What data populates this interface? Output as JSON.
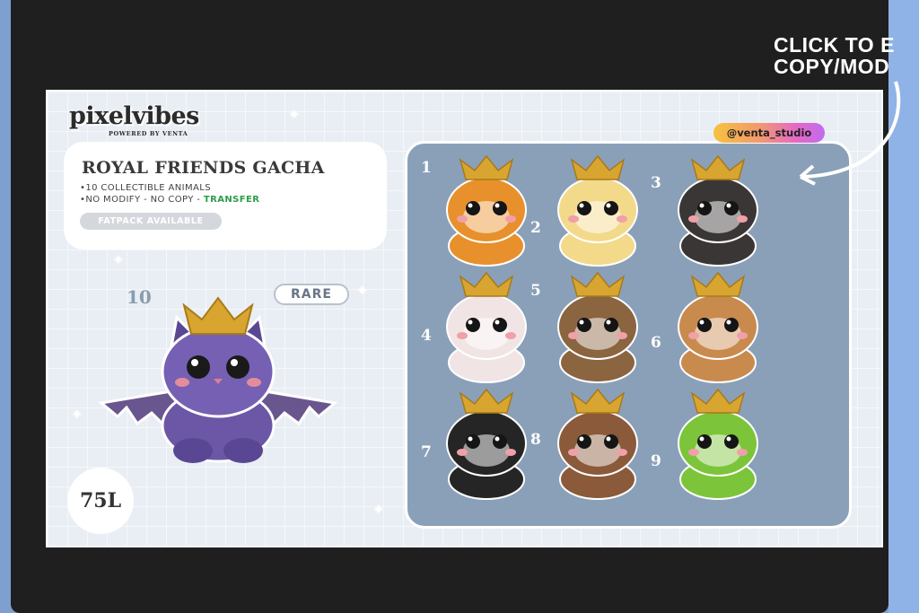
{
  "brand": {
    "name": "pixelvibes",
    "tagline": "POWERED BY VENTA"
  },
  "product": {
    "title": "ROYAL FRIENDS GACHA",
    "features": [
      "10 COLLECTIBLE ANIMALS",
      "NO MODIFY - NO COPY -"
    ],
    "transfer_label": "TRANSFER",
    "fatpack_label": "FATPACK AVAILABLE",
    "price": "75L"
  },
  "featured": {
    "number": "10",
    "rarity": "RARE",
    "animal": "bat"
  },
  "handle": "@venta_studio",
  "overlay": {
    "line1": "CLICK TO E",
    "line2": "COPY/MOD"
  },
  "items": [
    {
      "number": "1",
      "animal": "lion",
      "color": "#e8902c"
    },
    {
      "number": "2",
      "animal": "duck",
      "color": "#f3d98a"
    },
    {
      "number": "3",
      "animal": "panda",
      "color": "#3b3636"
    },
    {
      "number": "4",
      "animal": "lamb",
      "color": "#f1e4e4"
    },
    {
      "number": "5",
      "animal": "owl",
      "color": "#8b6440"
    },
    {
      "number": "6",
      "animal": "bear",
      "color": "#c98a4e"
    },
    {
      "number": "7",
      "animal": "penguin",
      "color": "#252525"
    },
    {
      "number": "8",
      "animal": "otter",
      "color": "#8a5a3a"
    },
    {
      "number": "9",
      "animal": "frog",
      "color": "#7cc43a"
    }
  ],
  "colors": {
    "crown": "#d9a531",
    "panel": "#8aa0b8",
    "transfer": "#2e9d4a"
  }
}
